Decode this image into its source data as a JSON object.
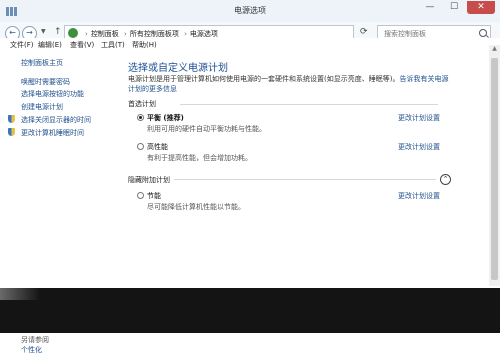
{
  "window": {
    "title": "电源选项",
    "minimize": "—",
    "maximize": "☐",
    "close": "✕"
  },
  "address": {
    "back": "←",
    "forward": "→",
    "up": "↑",
    "refresh": "⟳",
    "crumbs": [
      "控制面板",
      "所有控制面板项",
      "电源选项"
    ],
    "search_placeholder": "搜索控制面板"
  },
  "menu": [
    "文件(F)",
    "编辑(E)",
    "查看(V)",
    "工具(T)",
    "帮助(H)"
  ],
  "sidebar": {
    "home": "控制面板主页",
    "links": [
      "唤醒时需要密码",
      "选择电源按钮的功能",
      "创建电源计划",
      "选择关闭显示器的时间",
      "更改计算机睡眠时间"
    ],
    "see_also": "另请参阅",
    "bottom": "个性化"
  },
  "main": {
    "heading": "选择或自定义电源计划",
    "description": "电源计划是用于管理计算机如何使用电源的一套硬件和系统设置(如显示亮度、睡眠等)。",
    "description_link": "告诉我有关电源计划的更多信息",
    "preferred_label": "首选计划",
    "hidden_label": "隐藏附加计划",
    "collapse": "⌃",
    "plans": [
      {
        "name": "平衡 (推荐)",
        "desc": "利用可用的硬件自动平衡功耗与性能。",
        "link": "更改计划设置",
        "selected": true
      },
      {
        "name": "高性能",
        "desc": "有利于提高性能，但会增加功耗。",
        "link": "更改计划设置",
        "selected": false
      },
      {
        "name": "节能",
        "desc": "尽可能降低计算机性能以节能。",
        "link": "更改计划设置",
        "selected": false
      }
    ]
  },
  "colors": {
    "accent": "#1d4e96",
    "link": "#1f4f8e",
    "titlebar": "#eef3f9",
    "close": "#c74c4c"
  }
}
